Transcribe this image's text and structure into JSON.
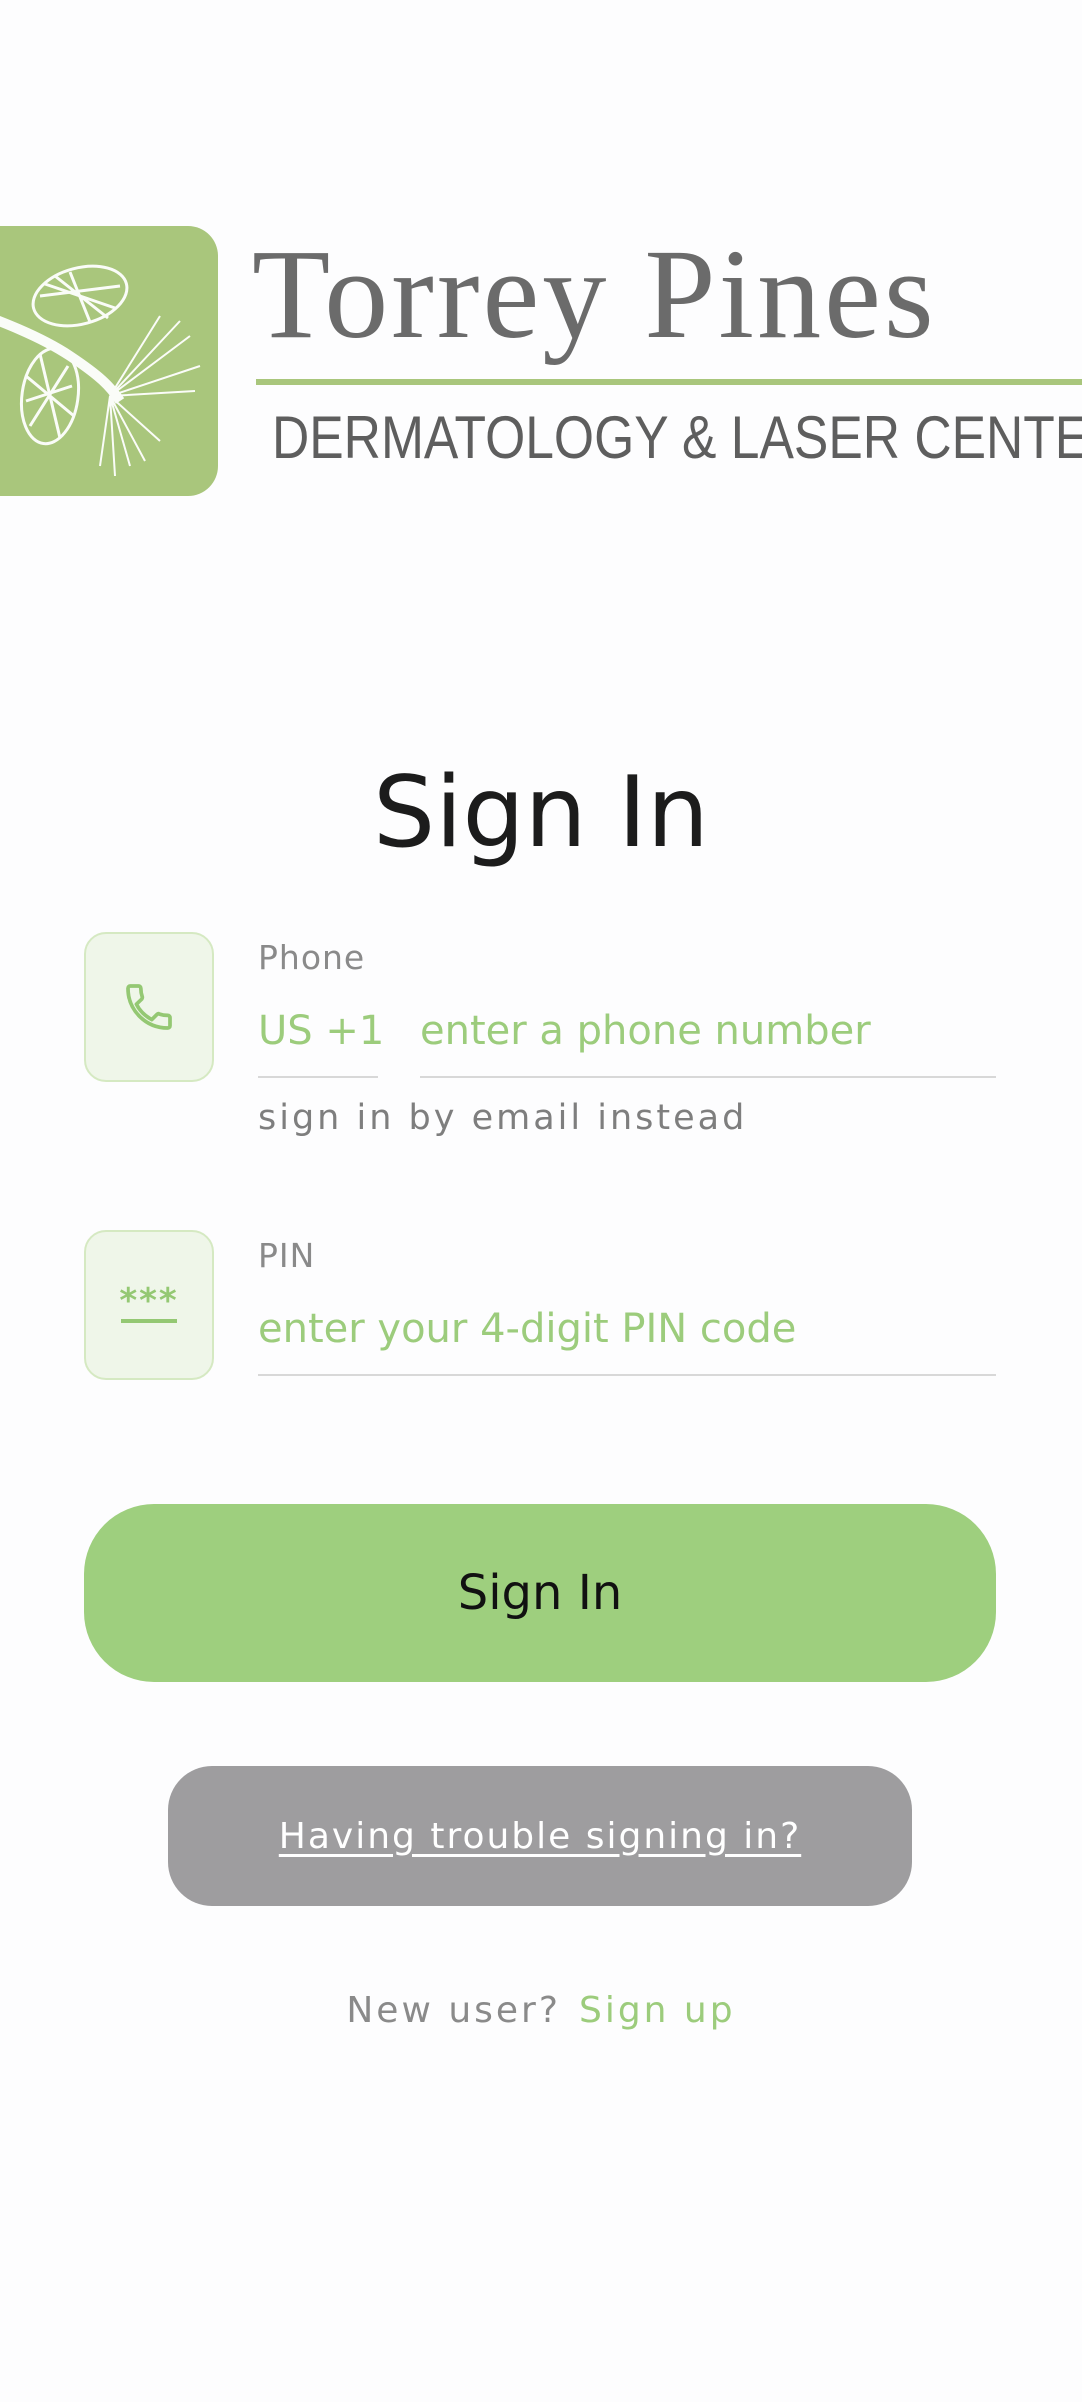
{
  "brand": {
    "name": "Torrey Pines",
    "tagline": "DERMATOLOGY & LASER CENTER",
    "accent_color": "#a9c67c"
  },
  "title": "Sign In",
  "phone": {
    "label": "Phone",
    "country_code": "US +1",
    "placeholder": "enter a phone number",
    "icon": "phone-icon"
  },
  "email_switch_link": "sign in by email instead",
  "pin": {
    "label": "PIN",
    "placeholder": "enter your 4-digit PIN code",
    "icon": "password-icon",
    "icon_glyph": "***"
  },
  "buttons": {
    "sign_in": "Sign In",
    "trouble": "Having trouble signing in?"
  },
  "signup": {
    "prompt": "New user?",
    "link": "Sign up"
  },
  "colors": {
    "primary_button": "#9ecf7e",
    "secondary_button": "#9e9d9f",
    "link_green": "#9ccc7c"
  }
}
